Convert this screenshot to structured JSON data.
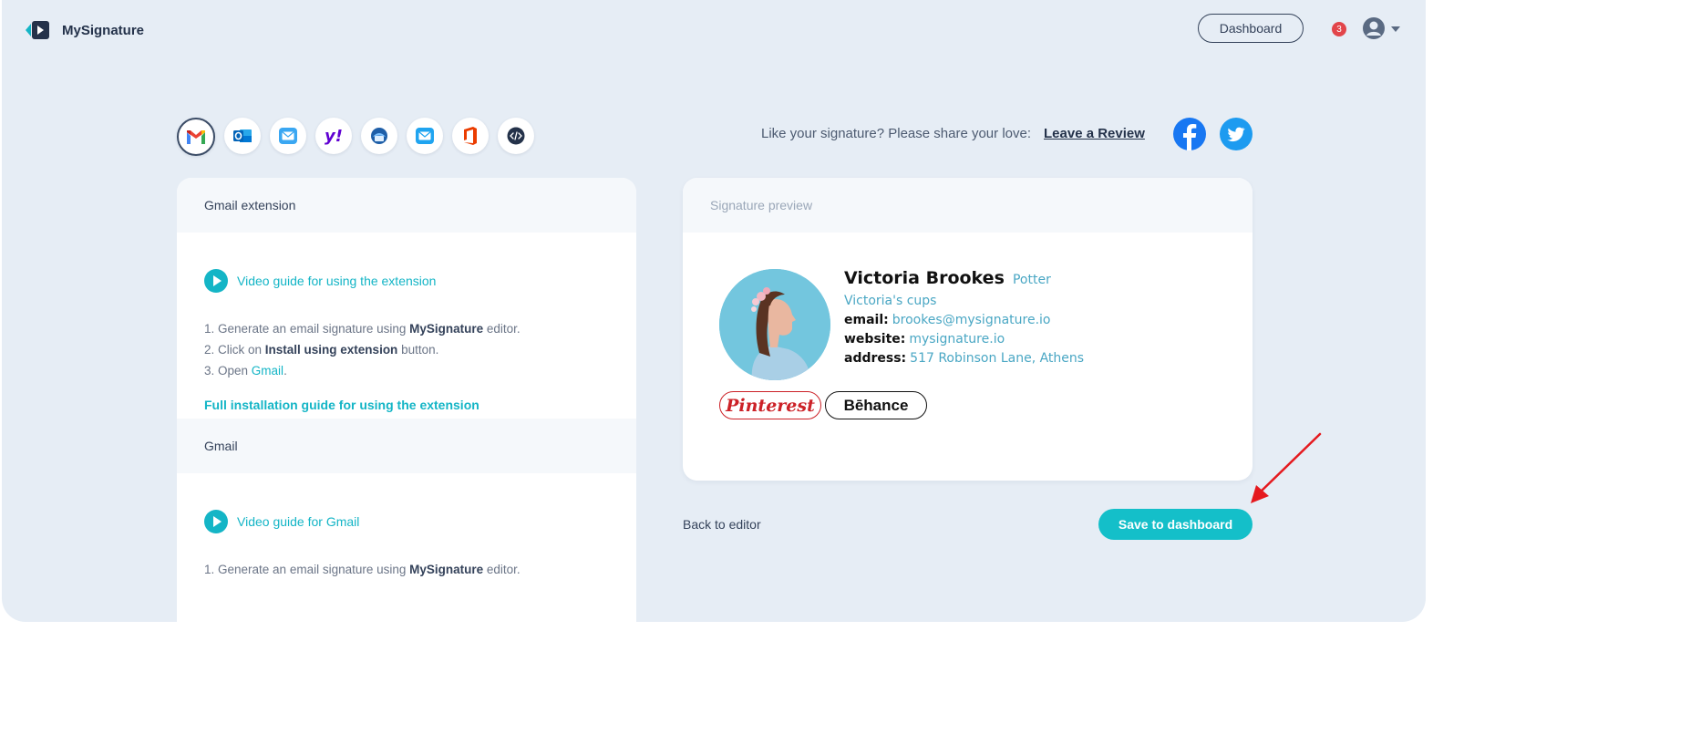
{
  "header": {
    "app_name": "MySignature",
    "dashboard_label": "Dashboard",
    "notification_count": "3"
  },
  "clients": [
    {
      "name": "gmail-icon",
      "active": true
    },
    {
      "name": "outlook-icon"
    },
    {
      "name": "apple-mail-icon"
    },
    {
      "name": "yahoo-icon"
    },
    {
      "name": "thunderbird-icon"
    },
    {
      "name": "mail-app-icon"
    },
    {
      "name": "office365-icon"
    },
    {
      "name": "html-code-icon"
    }
  ],
  "share": {
    "text": "Like your signature? Please share your love:",
    "review_label": "Leave a Review",
    "facebook_color": "#1877f2",
    "twitter_color": "#1d9bf0"
  },
  "left_panel": {
    "sections": [
      {
        "title": "Gmail extension",
        "video_label": "Video guide for using the extension",
        "steps": {
          "s1_a": "1. Generate an email signature using ",
          "s1_b": "MySignature",
          "s1_c": " editor.",
          "s2_a": "2. Click on ",
          "s2_b": "Install using extension",
          "s2_c": " button.",
          "s3_a": "3. Open ",
          "s3_b": "Gmail",
          "s3_c": "."
        },
        "full_guide": "Full installation guide for using the extension"
      },
      {
        "title": "Gmail",
        "video_label": "Video guide for Gmail",
        "steps": {
          "s1_a": "1. Generate an email signature using ",
          "s1_b": "MySignature",
          "s1_c": " editor."
        }
      }
    ]
  },
  "preview": {
    "title": "Signature preview",
    "name": "Victoria Brookes",
    "role": "Potter",
    "company": "Victoria's cups",
    "email_key": "email:",
    "email": "brookes@mysignature.io",
    "website_key": "website:",
    "website": "mysignature.io",
    "address_key": "address:",
    "address": "517 Robinson Lane, Athens",
    "badges": [
      "Pinterest",
      "Bēhance"
    ]
  },
  "actions": {
    "back_label": "Back to editor",
    "save_label": "Save to dashboard"
  },
  "colors": {
    "accent": "#14bfc9",
    "background": "#e6edf5",
    "annotation_arrow": "#e5191e"
  }
}
